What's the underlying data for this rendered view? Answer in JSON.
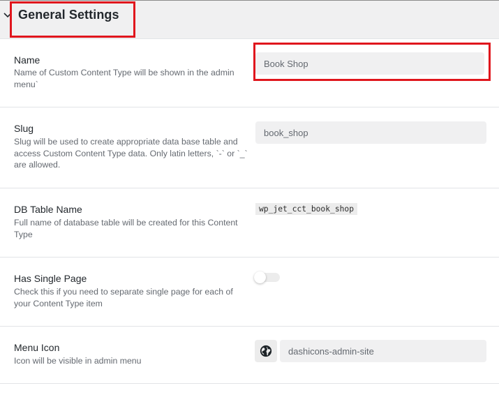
{
  "section": {
    "title": "General Settings"
  },
  "fields": {
    "name": {
      "label": "Name",
      "description": "Name of Custom Content Type will be shown in the admin menu`",
      "value": "Book Shop"
    },
    "slug": {
      "label": "Slug",
      "description": "Slug will be used to create appropriate data base table and access Custom Content Type data. Only latin letters, `-` or `_` are allowed.",
      "value": "book_shop"
    },
    "db_table": {
      "label": "DB Table Name",
      "description": "Full name of database table will be created for this Content Type",
      "value": "wp_jet_cct_book_shop"
    },
    "single_page": {
      "label": "Has Single Page",
      "description": "Check this if you need to separate single page for each of your Content Type item",
      "enabled": false
    },
    "menu_icon": {
      "label": "Menu Icon",
      "description": "Icon will be visible in admin menu",
      "value": "dashicons-admin-site",
      "icon": "globe-icon"
    }
  },
  "colors": {
    "highlight": "#e0161d",
    "input_bg": "#f0f0f1",
    "header_bg": "#f0f0f1"
  }
}
